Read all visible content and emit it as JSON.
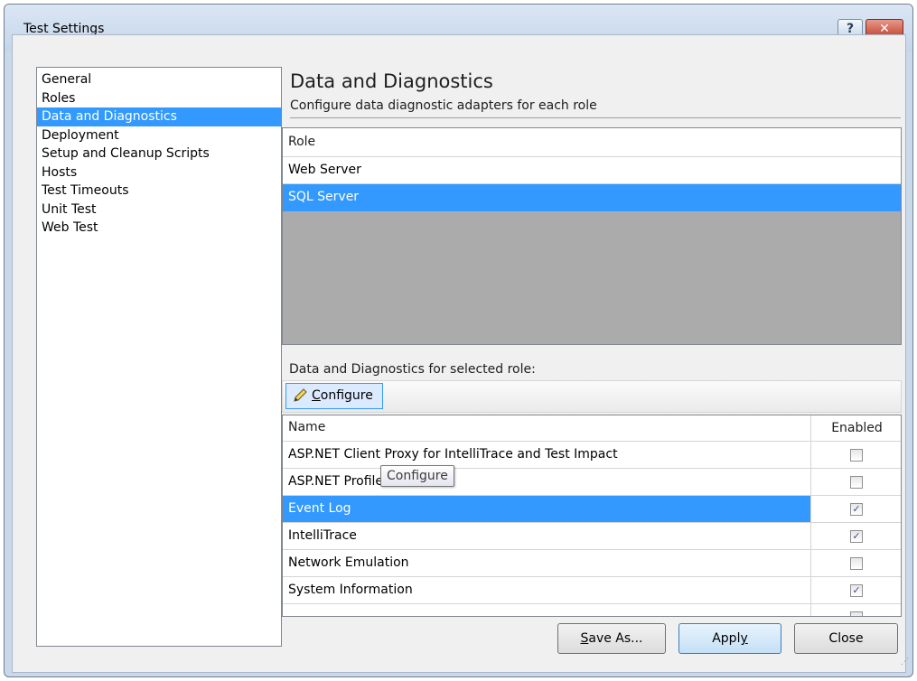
{
  "window": {
    "title": "Test Settings",
    "help_label": "?",
    "close_label": "✕"
  },
  "nav": {
    "items": [
      {
        "label": "General"
      },
      {
        "label": "Roles"
      },
      {
        "label": "Data and Diagnostics",
        "selected": true
      },
      {
        "label": "Deployment"
      },
      {
        "label": "Setup and Cleanup Scripts"
      },
      {
        "label": "Hosts"
      },
      {
        "label": "Test Timeouts"
      },
      {
        "label": "Unit Test"
      },
      {
        "label": "Web Test"
      }
    ]
  },
  "main": {
    "heading": "Data and Diagnostics",
    "subheading": "Configure data diagnostic adapters for each role",
    "roles": {
      "column_header": "Role",
      "rows": [
        {
          "label": "Web Server"
        },
        {
          "label": "SQL Server",
          "selected": true
        }
      ]
    },
    "diagnostics_label": "Data and Diagnostics for selected role:",
    "configure_button": {
      "prefix": "C",
      "rest": "onfigure"
    },
    "tooltip": "Configure",
    "diagnostics": {
      "col_name": "Name",
      "col_enabled": "Enabled",
      "rows": [
        {
          "name": "ASP.NET Client Proxy for IntelliTrace and Test Impact",
          "enabled": false
        },
        {
          "name": "ASP.NET Profiler",
          "enabled": false
        },
        {
          "name": "Event Log",
          "enabled": true,
          "selected": true
        },
        {
          "name": "IntelliTrace",
          "enabled": true
        },
        {
          "name": "Network Emulation",
          "enabled": false
        },
        {
          "name": "System Information",
          "enabled": true
        }
      ]
    }
  },
  "footer": {
    "save_as": {
      "prefix": "S",
      "rest": "ave As..."
    },
    "apply": {
      "prefix": "Appl",
      "underline": "y"
    },
    "close": "Close"
  },
  "colors": {
    "selection": "#3399ff",
    "grid_background": "#ababab"
  },
  "icons": {
    "configure": "pencil-icon",
    "checkbox_checked": "checkmark-icon"
  }
}
